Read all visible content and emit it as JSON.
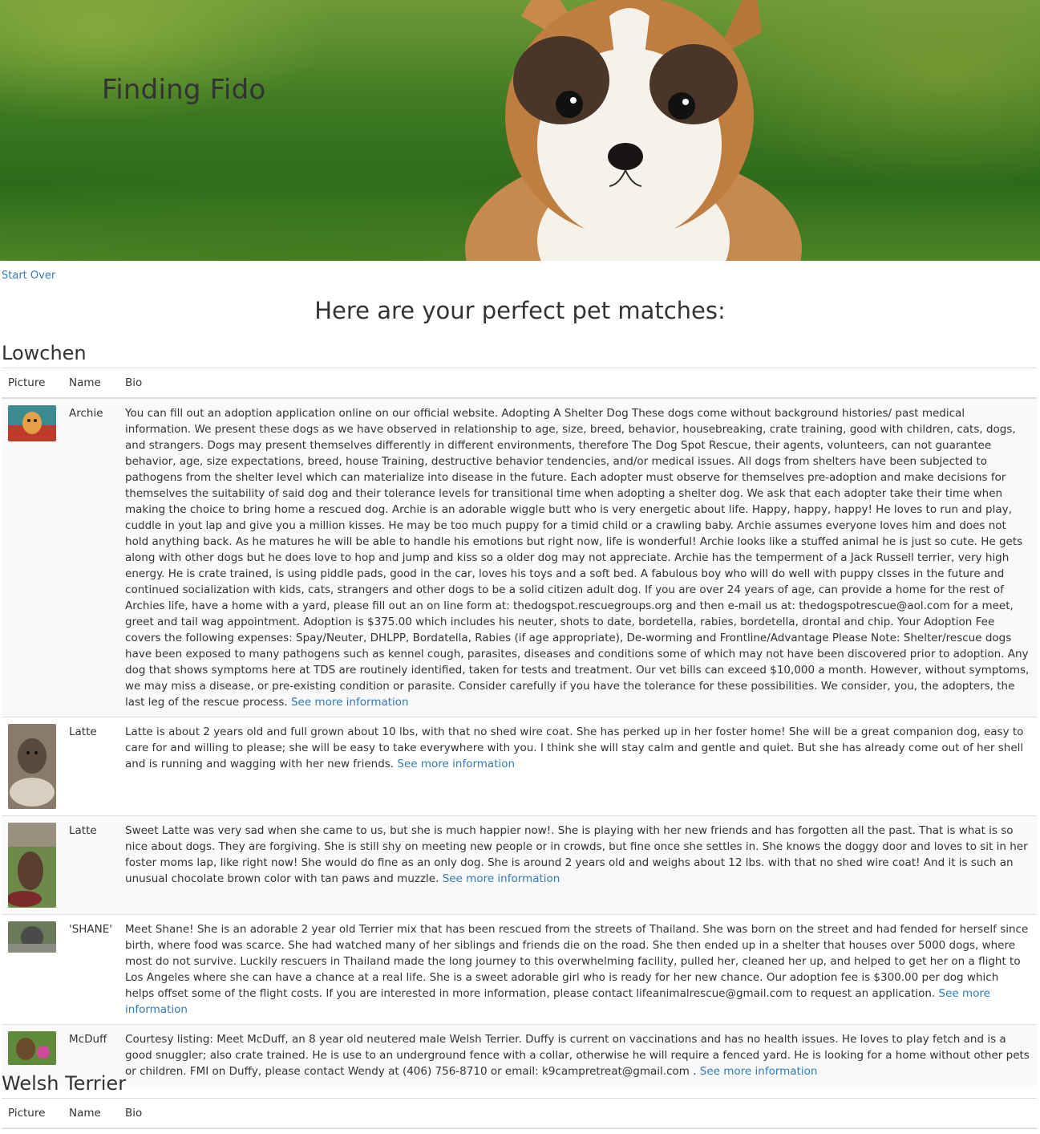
{
  "site": {
    "title": "Finding Fido"
  },
  "nav": {
    "start_over": "Start Over"
  },
  "results": {
    "heading": "Here are your perfect pet matches:"
  },
  "table_headers": {
    "picture": "Picture",
    "name": "Name",
    "bio": "Bio"
  },
  "see_more_label": "See more information",
  "breeds": [
    {
      "name": "Lowchen",
      "pets": [
        {
          "name": "Archie",
          "thumb_colors": [
            "#c0392b",
            "#3a8a8f",
            "#e6a04a"
          ],
          "bio": "You can fill out an adoption application online on our official website. Adopting A Shelter Dog These dogs come without background histories/ past medical information. We present these dogs as we have observed in relationship to age, size, breed, behavior, housebreaking, crate training, good with children, cats, dogs, and strangers. Dogs may present themselves differently in different environments, therefore The Dog Spot Rescue, their agents, volunteers, can not guarantee behavior, age, size expectations, breed, house Training, destructive behavior tendencies, and/or medical issues. All dogs from shelters have been subjected to pathogens from the shelter level which can materialize into disease in the future. Each adopter must observe for themselves pre-adoption and make decisions for themselves the suitability of said dog and their tolerance levels for transitional time when adopting a shelter dog. We ask that each adopter take their time when making the choice to bring home a rescued dog. Archie is an adorable wiggle butt who is very energetic about life. Happy, happy, happy! He loves to run and play, cuddle in yout lap and give you a million kisses. He may be too much puppy for a timid child or a crawling baby. Archie assumes everyone loves him and does not hold anything back. As he matures he will be able to handle his emotions but right now, life is wonderful! Archie looks like a stuffed animal he is just so cute. He gets along with other dogs but he does love to hop and jump and kiss so a older dog may not appreciate. Archie has the temperment of a Jack Russell terrier, very high energy. He is crate trained, is using piddle pads, good in the car, loves his toys and a soft bed. A fabulous boy who will do well with puppy clsses in the future and continued socialization with kids, cats, strangers and other dogs to be a solid citizen adult dog. If you are over 24 years of age, can provide a home for the rest of Archies life, have a home with a yard, please fill out an on line form at: thedogspot.rescuegroups.org and then e-mail us at: thedogspotrescue@aol.com for a meet, greet and tail wag appointment. Adoption is $375.00 which includes his neuter, shots to date, bordetella, rabies, bordetella, drontal and chip. Your Adoption Fee covers the following expenses: Spay/Neuter, DHLPP, Bordatella, Rabies (if age appropriate), De-worming and Frontline/Advantage Please Note: Shelter/rescue dogs have been exposed to many pathogens such as kennel cough, parasites, diseases and conditions some of which may not have been discovered prior to adoption. Any dog that shows symptoms here at TDS are routinely identified, taken for tests and treatment. Our vet bills can exceed $10,000 a month. However, without symptoms, we may miss a disease, or pre-existing condition or parasite. Consider carefully if you have the tolerance for these possibilities. We consider, you, the adopters, the last leg of the rescue process."
        },
        {
          "name": "Latte",
          "thumb_colors": [
            "#8a7a6a",
            "#5a4a3e",
            "#d8cfc0"
          ],
          "bio": "Latte is about 2 years old and full grown about 10 lbs, with that no shed wire coat. She has perked up in her foster home! She will be a great companion dog, easy to care for and willing to please; she will be easy to take everywhere with you. I think she will stay calm and gentle and quiet. But she has already come out of her shell and is running and wagging with her new friends."
        },
        {
          "name": "Latte",
          "thumb_colors": [
            "#6d8a4a",
            "#5a3e30",
            "#9a9080"
          ],
          "bio": "Sweet Latte was very sad when she came to us, but she is much happier now!. She is playing with her new friends and has forgotten all the past. That is what is so nice about dogs. They are forgiving. She is still shy on meeting new people or in crowds, but fine once she settles in. She knows the doggy door and loves to sit in her foster moms lap, like right now! She would do fine as an only dog. She is around 2 years old and weighs about 12 lbs. with that no shed wire coat! And it is such an unusual chocolate brown color with tan paws and muzzle."
        },
        {
          "name": "'SHANE'",
          "thumb_colors": [
            "#6a7a5a",
            "#4a4a48",
            "#8a8a80"
          ],
          "bio": "Meet Shane! She is an adorable 2 year old Terrier mix that has been rescued from the streets of Thailand. She was born on the street and had fended for herself since birth, where food was scarce. She had watched many of her siblings and friends die on the road. She then ended up in a shelter that houses over 5000 dogs, where most do not survive. Luckily rescuers in Thailand made the long journey to this overwhelming facility, pulled her, cleaned her up, and helped to get her on a flight to Los Angeles where she can have a chance at a real life. She is a sweet adorable girl who is ready for her new chance. Our adoption fee is $300.00 per dog which helps offset some of the flight costs. If you are interested in more information, please contact lifeanimalrescue@gmail.com to request an application."
        },
        {
          "name": "McDuff",
          "thumb_colors": [
            "#5f8a3a",
            "#6a4a2a",
            "#d04a9a"
          ],
          "bio": "Courtesy listing: Meet McDuff, an 8 year old neutered male Welsh Terrier. Duffy is current on vaccinations and has no health issues. He loves to play fetch and is a good snuggler; also crate trained. He is use to an underground fence with a collar, otherwise he will require a fenced yard. He is looking for a home without other pets or children. FMI on Duffy, please contact Wendy at (406) 756-8710 or email: k9campretreat@gmail.com ."
        }
      ]
    },
    {
      "name": "Welsh Terrier",
      "pets": []
    }
  ]
}
